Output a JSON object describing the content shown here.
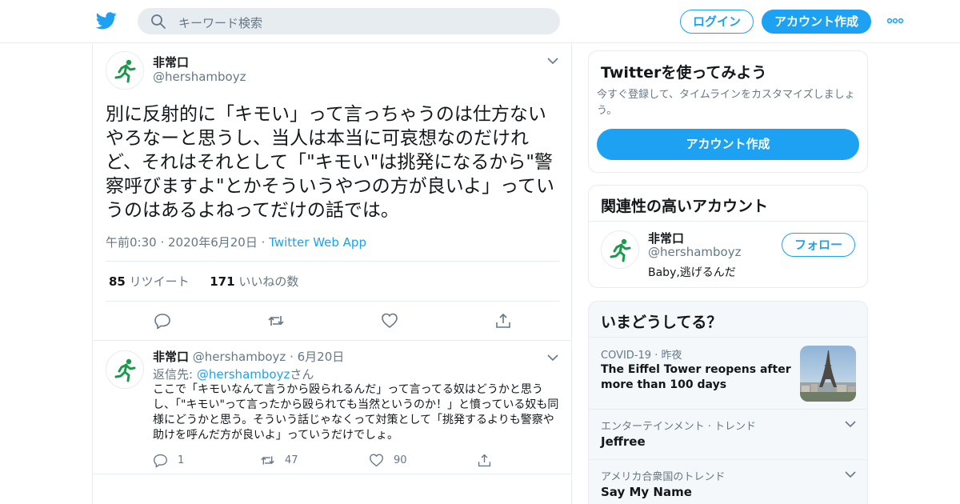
{
  "header": {
    "search_placeholder": "キーワード検索",
    "login_label": "ログイン",
    "signup_label": "アカウント作成"
  },
  "tweet": {
    "name": "非常口",
    "handle": "@hershamboyz",
    "text": "別に反射的に「キモい」って言っちゃうのは仕方ないやろなーと思うし、当人は本当に可哀想なのだけれど、それはそれとして「\"キモい\"は挑発になるから\"警察呼びますよ\"とかそういうやつの方が良いよ」っていうのはあるよねってだけの話では。",
    "time": "午前0:30",
    "date": "2020年6月20日",
    "source": "Twitter Web App",
    "retweets": "85",
    "retweets_label": "リツイート",
    "likes": "171",
    "likes_label": "いいねの数"
  },
  "reply": {
    "name": "非常口",
    "handle": "@hershamboyz",
    "date": "6月20日",
    "reply_prefix": "返信先:",
    "reply_handle": "@hershamboyz",
    "reply_suffix": "さん",
    "text": "ここで「キモいなんて言うから殴られるんだ」って言ってる奴はどうかと思うし、「\"キモい\"って言ったから殴られても当然というのか！」と憤っている奴も同様にどうかと思う。そういう話じゃなくって対策として「挑発するよりも警察や助けを呼んだ方が良いよ」っていうだけでしょ。",
    "replies": "1",
    "retweets": "47",
    "likes": "90"
  },
  "sidebar": {
    "try": {
      "title": "Twitterを使ってみよう",
      "desc": "今すぐ登録して、タイムラインをカスタマイズしましょう。",
      "button": "アカウント作成"
    },
    "related": {
      "title": "関連性の高いアカウント",
      "name": "非常口",
      "handle": "@hershamboyz",
      "bio": "Baby,逃げるんだ",
      "follow": "フォロー"
    },
    "trends": {
      "title": "いまどうしてる？",
      "items": [
        {
          "category": "COVID-19",
          "time": "昨夜",
          "name": "The Eiffel Tower reopens after more than 100 days"
        },
        {
          "category": "エンターテインメント · トレンド",
          "name": "Jeffree"
        },
        {
          "category": "アメリカ合衆国のトレンド",
          "name": "Say My Name"
        }
      ]
    }
  },
  "colors": {
    "accent": "#1da1f2",
    "text": "#14171a",
    "secondary": "#657786",
    "border": "#e6ecf0",
    "exit_green": "#1a9a4a"
  }
}
